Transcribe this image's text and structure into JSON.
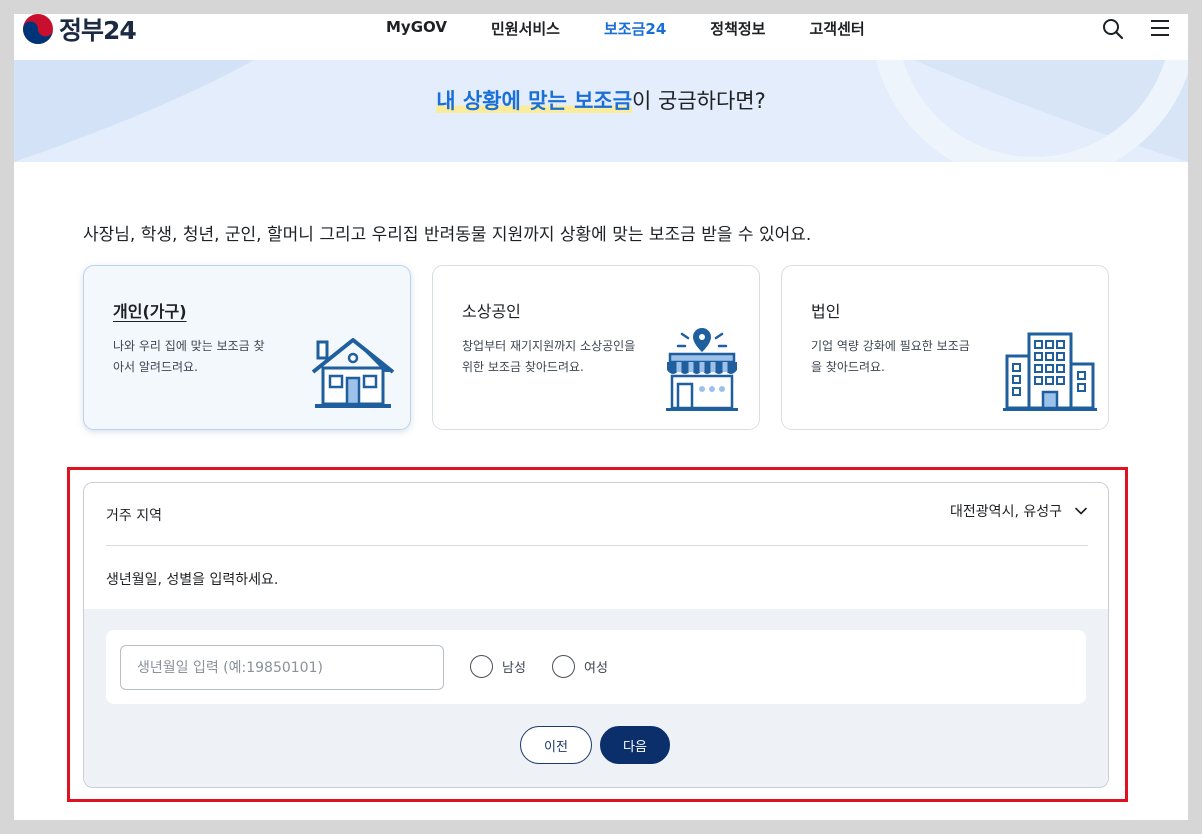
{
  "header": {
    "logo_text": "정부24",
    "nav": [
      "MyGOV",
      "민원서비스",
      "보조금24",
      "정책정보",
      "고객센터"
    ],
    "active_nav": "보조금24",
    "icons": [
      "search-icon",
      "menu-icon"
    ]
  },
  "hero": {
    "title_highlight": "내 상황에 맞는 보조금",
    "title_rest": "이 궁금하다면?"
  },
  "intro": "사장님, 학생, 청년, 군인, 할머니 그리고 우리집 반려동물 지원까지 상황에 맞는 보조금 받을 수 있어요.",
  "cards": [
    {
      "title": "개인(가구)",
      "desc": "나와 우리 집에 맞는 보조금 찾아서 알려드려요.",
      "icon": "house-icon",
      "selected": true
    },
    {
      "title": "소상공인",
      "desc": "창업부터 재기지원까지 소상공인을 위한 보조금 찾아드려요.",
      "icon": "store-icon",
      "selected": false
    },
    {
      "title": "법인",
      "desc": "기업 역량 강화에 필요한 보조금을 찾아드려요.",
      "icon": "building-icon",
      "selected": false
    }
  ],
  "form": {
    "region_label": "거주 지역",
    "region_value": "대전광역시, 유성구",
    "birth_prompt": "생년월일, 성별을 입력하세요.",
    "birth_placeholder": "생년월일 입력 (예:19850101)",
    "birth_value": "",
    "gender_options": [
      "남성",
      "여성"
    ],
    "prev_label": "이전",
    "next_label": "다음"
  },
  "colors": {
    "accent": "#1a6ed8",
    "navy": "#0b2f6b",
    "hero_bg": "#e3edfb",
    "highlight_border": "#e0121f",
    "icon_blue": "#1f5f9e"
  }
}
